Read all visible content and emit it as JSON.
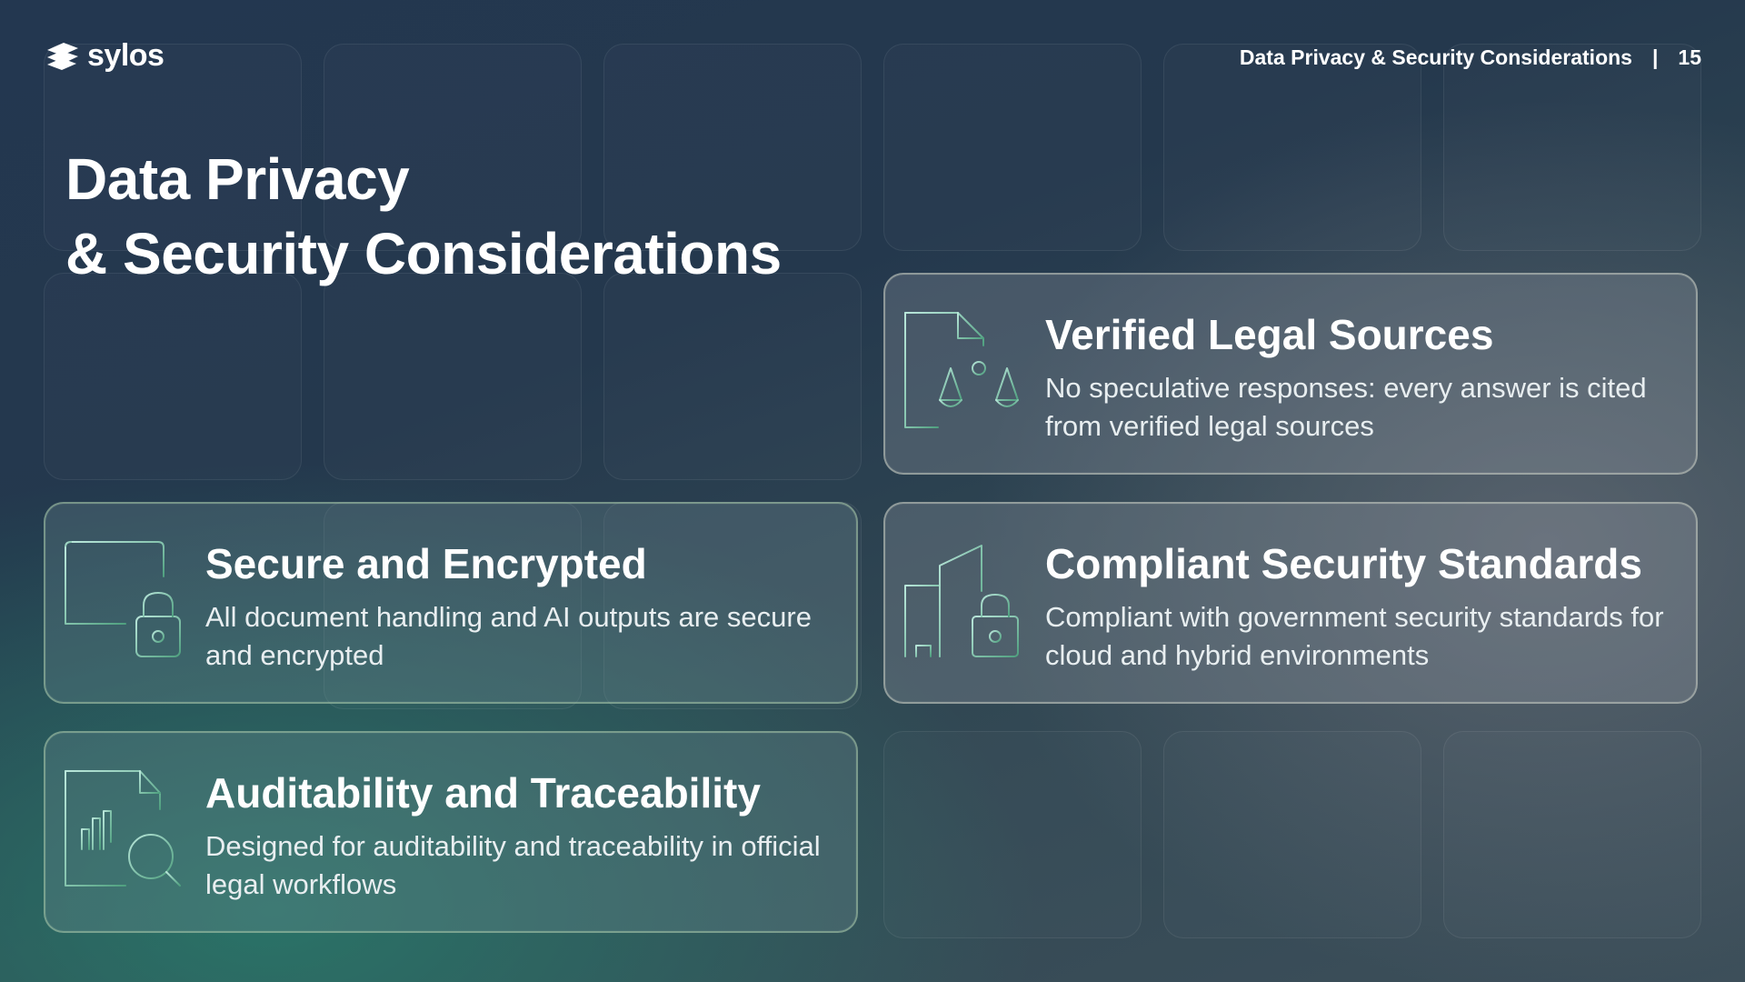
{
  "brand": {
    "name": "sylos"
  },
  "header": {
    "section": "Data Privacy & Security Considerations",
    "separator": "|",
    "page_number": "15"
  },
  "title": {
    "line1": "Data Privacy",
    "line2": "& Security Considerations"
  },
  "cards": [
    {
      "icon": "document-scales-icon",
      "title": "Verified Legal Sources",
      "description": "No speculative responses: every answer is cited from verified legal sources"
    },
    {
      "icon": "table-lock-icon",
      "title": "Secure and Encrypted",
      "description": "All document handling and AI outputs are secure and encrypted"
    },
    {
      "icon": "buildings-lock-icon",
      "title": "Compliant Security Standards",
      "description": "Compliant with government security standards for cloud and hybrid environments"
    },
    {
      "icon": "document-chart-search-icon",
      "title": "Auditability and Traceability",
      "description": "Designed for auditability and traceability in official legal workflows"
    }
  ],
  "colors": {
    "icon_gradient_start": "#8fd9c0",
    "icon_gradient_end": "#4fa07f"
  }
}
